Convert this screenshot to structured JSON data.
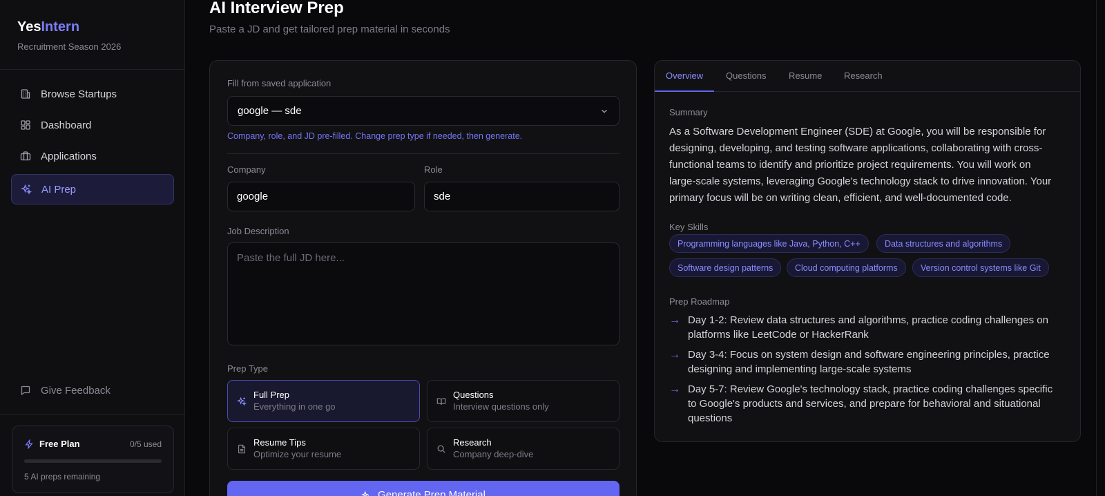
{
  "brand": {
    "name_part1": "Yes",
    "name_part2": "Intern",
    "season": "Recruitment Season 2026"
  },
  "nav": [
    {
      "label": "Browse Startups",
      "icon": "building-icon",
      "active": false
    },
    {
      "label": "Dashboard",
      "icon": "dashboard-grid-icon",
      "active": false
    },
    {
      "label": "Applications",
      "icon": "briefcase-icon",
      "active": false
    },
    {
      "label": "AI Prep",
      "icon": "sparkles-icon",
      "active": true
    }
  ],
  "feedback": {
    "label": "Give Feedback",
    "icon": "message-square-icon"
  },
  "plan": {
    "name": "Free Plan",
    "used": "0/5 used",
    "used_fraction": 0,
    "remaining": "5 AI preps remaining"
  },
  "header": {
    "title": "AI Interview Prep",
    "subtitle": "Paste a JD and get tailored prep material in seconds"
  },
  "form": {
    "saved_label": "Fill from saved application",
    "saved_value": "google — sde",
    "hint": "Company, role, and JD pre-filled. Change prep type if needed, then generate.",
    "company_label": "Company",
    "company_value": "google",
    "role_label": "Role",
    "role_value": "sde",
    "jd_label": "Job Description",
    "jd_placeholder": "Paste the full JD here...",
    "prep_type_label": "Prep Type",
    "prep_types": [
      {
        "title": "Full Prep",
        "desc": "Everything in one go",
        "icon": "sparkles-icon",
        "selected": true
      },
      {
        "title": "Questions",
        "desc": "Interview questions only",
        "icon": "book-open-icon",
        "selected": false
      },
      {
        "title": "Resume Tips",
        "desc": "Optimize your resume",
        "icon": "file-text-icon",
        "selected": false
      },
      {
        "title": "Research",
        "desc": "Company deep-dive",
        "icon": "search-icon",
        "selected": false
      }
    ],
    "generate_label": "Generate Prep Material"
  },
  "results": {
    "tabs": [
      "Overview",
      "Questions",
      "Resume",
      "Research"
    ],
    "active_tab": "Overview",
    "summary_label": "Summary",
    "summary": "As a Software Development Engineer (SDE) at Google, you will be responsible for designing, developing, and testing software applications, collaborating with cross-functional teams to identify and prioritize project requirements. You will work on large-scale systems, leveraging Google's technology stack to drive innovation. Your primary focus will be on writing clean, efficient, and well-documented code.",
    "skills_label": "Key Skills",
    "skills": [
      "Programming languages like Java, Python, C++",
      "Data structures and algorithms",
      "Software design patterns",
      "Cloud computing platforms",
      "Version control systems like Git"
    ],
    "roadmap_label": "Prep Roadmap",
    "roadmap_arrow": "→",
    "roadmap": [
      "Day 1-2: Review data structures and algorithms, practice coding challenges on platforms like LeetCode or HackerRank",
      "Day 3-4: Focus on system design and software engineering principles, practice designing and implementing large-scale systems",
      "Day 5-7: Review Google's technology stack, practice coding challenges specific to Google's products and services, and prepare for behavioral and situational questions"
    ]
  },
  "colors": {
    "accent": "#6366f1",
    "accent_text": "#8b8bff",
    "background": "#09090b",
    "card": "#111114"
  }
}
